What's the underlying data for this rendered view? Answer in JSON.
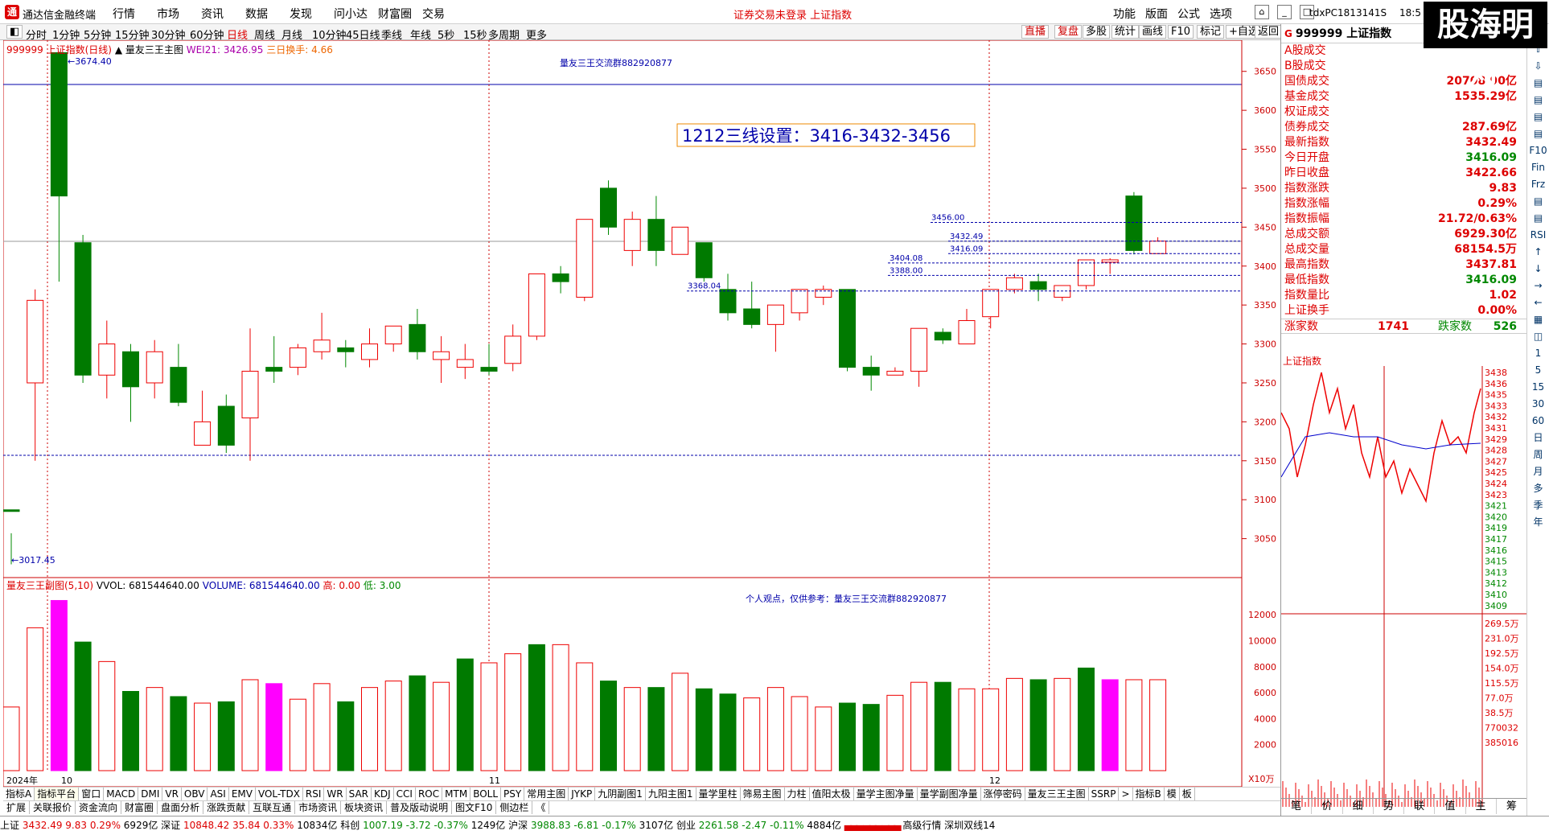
{
  "titlebar": {
    "appname": "通达信金融终端",
    "menus": [
      "行情",
      "市场",
      "资讯",
      "数据",
      "发现",
      "问小达",
      "财富圈",
      "交易"
    ],
    "notice": "证券交易未登录  上证指数",
    "rmenus": [
      "功能",
      "版面",
      "公式",
      "选项"
    ],
    "host": "tdxPC1813141S",
    "clock": "18:5",
    "brand": "股海明灯"
  },
  "periods": [
    "分时",
    "1分钟",
    "5分钟",
    "15分钟",
    "30分钟",
    "60分钟",
    "日线",
    "周线",
    "月线",
    "10分钟",
    "45日线",
    "季线",
    "年线",
    "5秒",
    "15秒",
    "多周期",
    "更多"
  ],
  "active_period": "日线",
  "toolbtns": [
    "直播",
    "复盘",
    "多股",
    "统计",
    "画线",
    "F10",
    "标记",
    "+自选",
    "返回"
  ],
  "legend1": {
    "a": "999999 上证指数(日线)",
    "b": "▲ 量友三王主图",
    "c": "WEI21: 3426.95",
    "d": "三日换手: 4.66"
  },
  "legend2": {
    "a": "量友三王副图(5,10)",
    "b": "VVOL: 681544640.00",
    "c": "VOLUME: 681544640.00",
    "d": "高: 0.00",
    "e": "低: 3.00"
  },
  "annot": {
    "group": "量友三王交流群882920877",
    "setting": "1212三线设置：3416-3432-3456",
    "hi": "3674.40",
    "lo": "3017.45",
    "note2": "个人观点，仅供参考：量友三王交流群882920877",
    "lbl3368": "3368.04",
    "lbl3456": "3456.00",
    "lbl3432": "3432.49",
    "lbl3416": "3416.09",
    "lbl3404": "3404.08",
    "lbl3388": "3388.00",
    "yrlabel": "2024年",
    "m10": "10",
    "m11": "11",
    "m12": "12",
    "xunit": "X10万"
  },
  "chart_data": {
    "type": "candlestick",
    "yaxis": [
      "3650",
      "3600",
      "3550",
      "3500",
      "3450",
      "3400",
      "3350",
      "3300",
      "3250",
      "3200",
      "3150",
      "3100",
      "3050"
    ],
    "volaxis": [
      "12000",
      "10000",
      "8000",
      "6000",
      "4000",
      "2000"
    ],
    "candles": [
      [
        3087,
        3087,
        3057,
        3017
      ],
      [
        3356,
        3250,
        3370,
        3150
      ],
      [
        3490,
        3674,
        3674,
        3380
      ],
      [
        3430,
        3260,
        3440,
        3250
      ],
      [
        3260,
        3300,
        3330,
        3230
      ],
      [
        3290,
        3245,
        3300,
        3200
      ],
      [
        3290,
        3250,
        3305,
        3230
      ],
      [
        3270,
        3225,
        3300,
        3220
      ],
      [
        3170,
        3200,
        3240,
        3170
      ],
      [
        3220,
        3170,
        3235,
        3160
      ],
      [
        3205,
        3265,
        3320,
        3150
      ],
      [
        3265,
        3270,
        3310,
        3250
      ],
      [
        3270,
        3295,
        3300,
        3260
      ],
      [
        3290,
        3305,
        3340,
        3280
      ],
      [
        3295,
        3290,
        3305,
        3270
      ],
      [
        3280,
        3300,
        3320,
        3270
      ],
      [
        3300,
        3323,
        3320,
        3290
      ],
      [
        3325,
        3290,
        3345,
        3280
      ],
      [
        3280,
        3290,
        3310,
        3250
      ],
      [
        3270,
        3280,
        3300,
        3255
      ],
      [
        3265,
        3270,
        3300,
        3260
      ],
      [
        3275,
        3310,
        3325,
        3265
      ],
      [
        3310,
        3390,
        3390,
        3305
      ],
      [
        3390,
        3380,
        3400,
        3365
      ],
      [
        3360,
        3460,
        3460,
        3355
      ],
      [
        3450,
        3500,
        3510,
        3440
      ],
      [
        3420,
        3460,
        3470,
        3400
      ],
      [
        3460,
        3420,
        3490,
        3400
      ],
      [
        3415,
        3450,
        3450,
        3415
      ],
      [
        3430,
        3385,
        3430,
        3380
      ],
      [
        3370,
        3340,
        3390,
        3330
      ],
      [
        3345,
        3325,
        3380,
        3320
      ],
      [
        3325,
        3350,
        3350,
        3290
      ],
      [
        3340,
        3370,
        3370,
        3330
      ],
      [
        3360,
        3370,
        3375,
        3350
      ],
      [
        3370,
        3270,
        3370,
        3265
      ],
      [
        3270,
        3260,
        3285,
        3240
      ],
      [
        3260,
        3265,
        3270,
        3260
      ],
      [
        3265,
        3320,
        3320,
        3245
      ],
      [
        3315,
        3305,
        3320,
        3300
      ],
      [
        3300,
        3330,
        3345,
        3300
      ],
      [
        3335,
        3370,
        3370,
        3320
      ],
      [
        3370,
        3385,
        3390,
        3365
      ],
      [
        3380,
        3370,
        3390,
        3355
      ],
      [
        3360,
        3375,
        3375,
        3355
      ],
      [
        3375,
        3408,
        3408,
        3370
      ],
      [
        3405,
        3408,
        3410,
        3390
      ],
      [
        3490,
        3420,
        3495,
        3415
      ],
      [
        3416,
        3432,
        3437,
        3416
      ]
    ],
    "up": [
      false,
      true,
      false,
      false,
      true,
      false,
      true,
      false,
      true,
      false,
      true,
      false,
      true,
      true,
      false,
      true,
      true,
      false,
      true,
      true,
      false,
      true,
      true,
      false,
      true,
      false,
      true,
      false,
      true,
      false,
      false,
      false,
      true,
      true,
      true,
      false,
      false,
      true,
      true,
      false,
      true,
      true,
      true,
      false,
      true,
      true,
      true,
      false,
      true
    ],
    "volumes": [
      4900,
      11000,
      13100,
      9900,
      8400,
      6100,
      6400,
      5700,
      5200,
      5300,
      7000,
      6700,
      5500,
      6700,
      5300,
      6400,
      6900,
      7300,
      6800,
      8600,
      8300,
      9000,
      9700,
      9700,
      8300,
      6900,
      6400,
      6400,
      7500,
      6300,
      5900,
      5600,
      6400,
      5700,
      4900,
      5200,
      5100,
      5800,
      6800,
      6800,
      6300,
      6300,
      7100,
      7000,
      7100,
      7900,
      7000,
      7000,
      7000
    ],
    "volcolors": [
      "r",
      "r",
      "m",
      "g",
      "r",
      "g",
      "r",
      "g",
      "r",
      "g",
      "r",
      "m",
      "r",
      "r",
      "g",
      "r",
      "r",
      "g",
      "r",
      "g",
      "r",
      "r",
      "g",
      "r",
      "r",
      "g",
      "r",
      "g",
      "r",
      "g",
      "g",
      "r",
      "r",
      "r",
      "r",
      "g",
      "g",
      "r",
      "r",
      "g",
      "r",
      "r",
      "r",
      "g",
      "r",
      "g",
      "m",
      "r",
      "r"
    ],
    "mini_ylabels": [
      "3438",
      "3436",
      "3435",
      "3433",
      "3432",
      "3431",
      "3429",
      "3428",
      "3427",
      "3425",
      "3424",
      "3423",
      "3421",
      "3420",
      "3419",
      "3417",
      "3416",
      "3415",
      "3413",
      "3412",
      "3410",
      "3409",
      "269.5万",
      "231.0万",
      "192.5万",
      "154.0万",
      "115.5万",
      "77.0万",
      "38.5万",
      "770032",
      "385016"
    ]
  },
  "rp": {
    "code": "999999",
    "name": "上证指数",
    "rows": [
      {
        "l": "A股成交",
        "v": ""
      },
      {
        "l": "B股成交",
        "v": ""
      },
      {
        "l": "国债成交",
        "v": "20708.90亿"
      },
      {
        "l": "基金成交",
        "v": "1535.29亿"
      },
      {
        "l": "权证成交",
        "v": ""
      },
      {
        "l": "债券成交",
        "v": "287.69亿"
      },
      {
        "l": "最新指数",
        "v": "3432.49"
      },
      {
        "l": "今日开盘",
        "v": "3416.09"
      },
      {
        "l": "昨日收盘",
        "v": "3422.66"
      },
      {
        "l": "指数涨跌",
        "v": "9.83"
      },
      {
        "l": "指数涨幅",
        "v": "0.29%"
      },
      {
        "l": "指数振幅",
        "v": "21.72/0.63%"
      },
      {
        "l": "总成交额",
        "v": "6929.30亿"
      },
      {
        "l": "总成交量",
        "v": "68154.5万"
      },
      {
        "l": "最高指数",
        "v": "3437.81"
      },
      {
        "l": "最低指数",
        "v": "3416.09"
      },
      {
        "l": "指数量比",
        "v": "1.02"
      },
      {
        "l": "上证换手",
        "v": "0.00%"
      }
    ],
    "updown": {
      "a": "涨家数",
      "b": "1741",
      "c": "跌家数",
      "d": "526"
    },
    "minititle": "上证指数",
    "tabs": [
      "笔",
      "价",
      "细",
      "势",
      "联",
      "值",
      "主",
      "筹"
    ]
  },
  "tabs1": [
    "指标A",
    "指标平台",
    "窗口",
    "MACD",
    "DMI",
    "VR",
    "OBV",
    "ASI",
    "EMV",
    "VOL-TDX",
    "RSI",
    "WR",
    "SAR",
    "KDJ",
    "CCI",
    "ROC",
    "MTM",
    "BOLL",
    "PSY",
    "常用主图",
    "JYKP",
    "九阴副图1",
    "九阳主图1",
    "量学里柱",
    "筛易主图",
    "力柱",
    "值阳太极",
    "量学主图净量",
    "量学副图净量",
    "涨停密码",
    "量友三王主图",
    "SSRP",
    ">",
    "指标B",
    "模",
    "板"
  ],
  "tabs2": [
    "扩展",
    "关联报价",
    "资金流向",
    "财富圈",
    "盘面分析",
    "涨跌贡献",
    "互联互通",
    "市场资讯",
    "板块资讯",
    "普及版动说明",
    "图文F10",
    "侧边栏",
    "《"
  ],
  "sidebar": [
    "×",
    "⇧",
    "⇩",
    "▤",
    "▤",
    "▤",
    "▤",
    "F10",
    "Fin",
    "Frz",
    "▤",
    "▤",
    "RSI",
    "↑",
    "↓",
    "→",
    "←",
    "▦",
    "◫",
    "1",
    "5",
    "15",
    "30",
    "60",
    "日",
    "周",
    "月",
    "多",
    "季",
    "年"
  ],
  "status": {
    "t1": "上证",
    "v1": "3432.49",
    "c1": "9.83",
    "p1": "0.29%",
    "a1": "6929亿",
    "t2": "深证",
    "v2": "10848.42",
    "c2": "35.84",
    "p2": "0.33%",
    "a2": "10834亿",
    "t3": "科创",
    "v3": "1007.19",
    "c3": "-3.72",
    "p3": "-0.37%",
    "a3": "1249亿",
    "t4": "沪深",
    "v4": "3988.83",
    "c4": "-6.81",
    "p4": "-0.17%",
    "a4": "3107亿",
    "t5": "创业",
    "v5": "2261.58",
    "c5": "-2.47",
    "p5": "-0.11%",
    "a5": "4884亿",
    "tail": "高级行情 深圳双线14"
  }
}
